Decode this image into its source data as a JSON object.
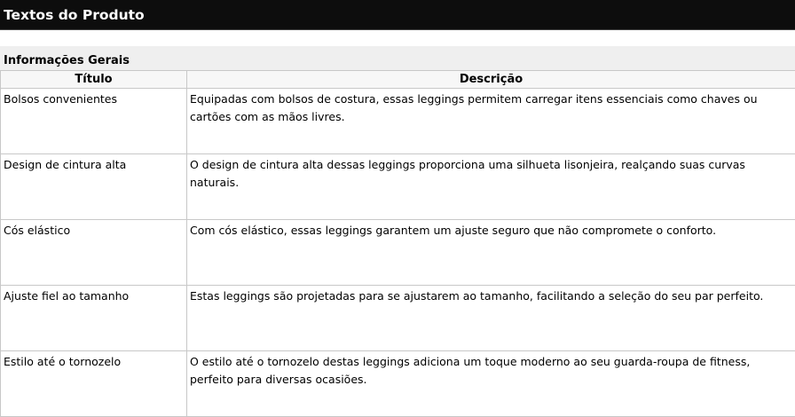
{
  "header": {
    "title": "Textos do Produto"
  },
  "section": {
    "title": "Informações Gerais"
  },
  "table": {
    "columns": [
      "Título",
      "Descrição"
    ],
    "rows": [
      {
        "title": "Bolsos convenientes",
        "description": "Equipadas com bolsos de costura, essas leggings permitem carregar itens essenciais como chaves ou cartões com as mãos livres."
      },
      {
        "title": "Design de cintura alta",
        "description": "O design de cintura alta dessas leggings proporciona uma silhueta lisonjeira, realçando suas curvas naturais."
      },
      {
        "title": "Cós elástico",
        "description": "Com cós elástico, essas leggings garantem um ajuste seguro que não compromete o conforto."
      },
      {
        "title": "Ajuste fiel ao tamanho",
        "description": "Estas leggings são projetadas para se ajustarem ao tamanho, facilitando a seleção do seu par perfeito."
      },
      {
        "title": "Estilo até o tornozelo",
        "description": "O estilo até o tornozelo destas leggings adiciona um toque moderno ao seu guarda-roupa de fitness, perfeito para diversas ocasiões."
      }
    ]
  },
  "colors": {
    "title_bar_bg": "#0d0d0d",
    "title_bar_text": "#ffffff",
    "section_bg": "#efefef",
    "grid_border": "#c8c8c8"
  }
}
